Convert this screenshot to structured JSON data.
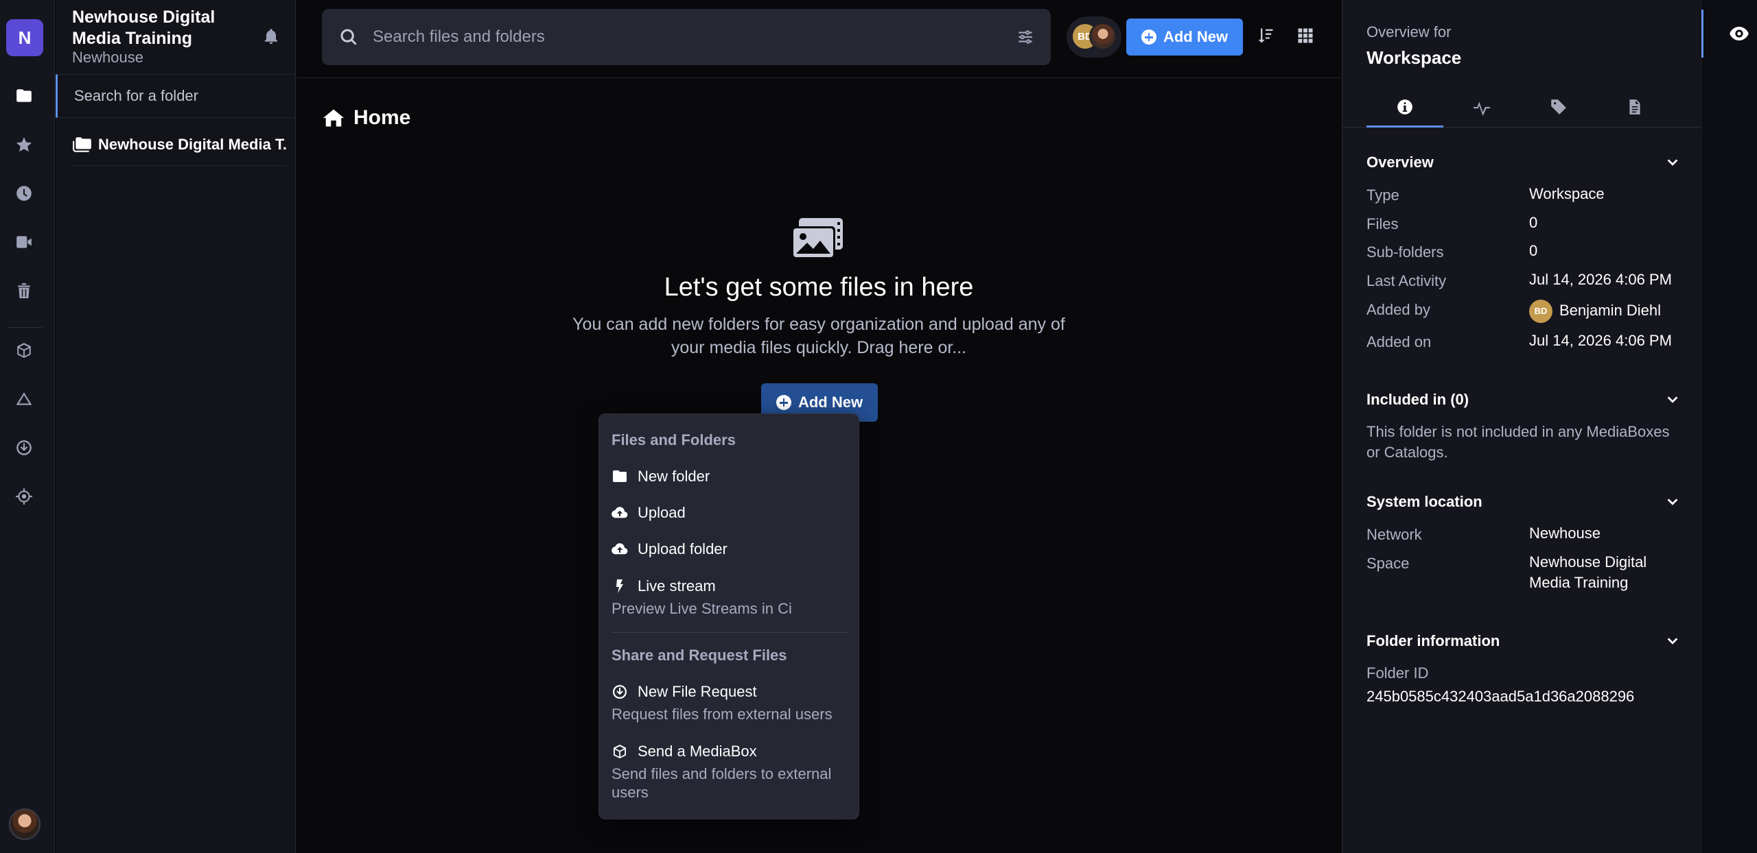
{
  "rail": {
    "logo_letter": "N",
    "items": [
      {
        "icon": "folder-icon"
      },
      {
        "icon": "star-icon"
      },
      {
        "icon": "clock-icon"
      },
      {
        "icon": "video-camera-icon"
      },
      {
        "icon": "trash-icon"
      },
      {
        "icon": "cube-icon"
      },
      {
        "icon": "cloud-triangle-icon"
      },
      {
        "icon": "file-request-icon"
      },
      {
        "icon": "target-icon"
      }
    ]
  },
  "sidebar": {
    "workspace_title": "Newhouse Digital Media Training",
    "workspace_network": "Newhouse",
    "folder_search_placeholder": "Search for a folder",
    "tree_item": "Newhouse Digital Media T..."
  },
  "header": {
    "search_placeholder": "Search files and folders",
    "avatar_initials": "BD",
    "add_new_label": "Add New"
  },
  "main": {
    "breadcrumb": "Home",
    "empty_title": "Let's get some files in here",
    "empty_text": "You can add new folders for easy organization and upload any of your media files quickly. Drag here or...",
    "add_new_label": "Add New"
  },
  "menu": {
    "section1": "Files and Folders",
    "new_folder": "New folder",
    "upload": "Upload",
    "upload_folder": "Upload folder",
    "live_stream": "Live stream",
    "live_stream_desc": "Preview Live Streams in Ci",
    "section2": "Share and Request Files",
    "new_file_request": "New File Request",
    "new_file_request_desc": "Request files from external users",
    "send_mediabox": "Send a MediaBox",
    "send_mediabox_desc": "Send files and folders to external users"
  },
  "panel": {
    "overview_for": "Overview for",
    "workspace": "Workspace",
    "overview": {
      "heading": "Overview",
      "rows": [
        {
          "key": "Type",
          "value": "Workspace"
        },
        {
          "key": "Files",
          "value": "0"
        },
        {
          "key": "Sub-folders",
          "value": "0"
        },
        {
          "key": "Last Activity",
          "value": "Jul 14, 2026 4:06 PM"
        },
        {
          "key": "Added by",
          "value": "Benjamin Diehl",
          "avatar": "BD"
        },
        {
          "key": "Added on",
          "value": "Jul 14, 2026 4:06 PM"
        }
      ]
    },
    "included": {
      "heading": "Included in (0)",
      "text": "This folder is not included in any MediaBoxes or Catalogs."
    },
    "system": {
      "heading": "System location",
      "network_key": "Network",
      "network_value": "Newhouse",
      "space_key": "Space",
      "space_value": "Newhouse Digital Media Training"
    },
    "folder_info": {
      "heading": "Folder information",
      "id_key": "Folder ID",
      "id_value": "245b0585c432403aad5a1d36a2088296"
    }
  },
  "colors": {
    "accent": "#3f86f5",
    "accent_dark": "#244f94",
    "logo": "#5b4ad6",
    "avatar": "#c49a4d"
  }
}
